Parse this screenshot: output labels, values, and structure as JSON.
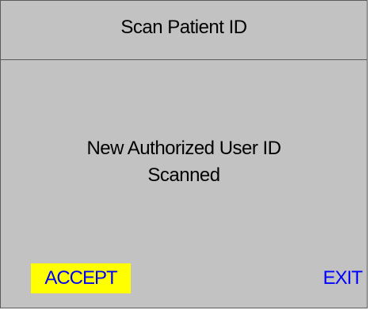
{
  "screen": {
    "title": "Scan Patient ID",
    "message_line1": "New Authorized User ID",
    "message_line2": "Scanned"
  },
  "actions": {
    "accept_label": "ACCEPT",
    "exit_label": "EXIT"
  },
  "colors": {
    "background": "#c2c2c2",
    "accent_highlight": "#ffff00",
    "action_text": "#0000ff"
  }
}
